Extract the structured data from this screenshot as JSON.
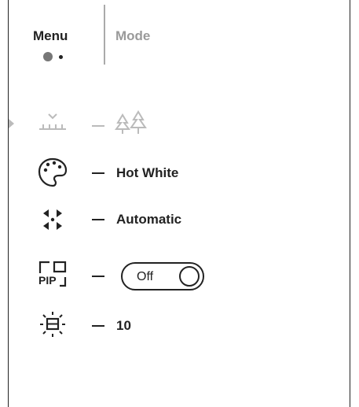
{
  "tabs": [
    {
      "label": "Menu",
      "active": true
    },
    {
      "label": "Mode",
      "active": false
    }
  ],
  "rows": [
    {
      "icon": "terrain-mode-icon",
      "value_icon": "forest-icon"
    },
    {
      "icon": "color-palette-icon",
      "value": "Hot White"
    },
    {
      "icon": "calibration-arrows-icon",
      "value": "Automatic"
    },
    {
      "icon": "pip-icon",
      "icon_text": "PIP",
      "toggle": {
        "label": "Off",
        "state": "off"
      }
    },
    {
      "icon": "display-brightness-icon",
      "value": "10"
    }
  ],
  "colors": {
    "active": "#222222",
    "inactive": "#9a9a9a",
    "disabled": "#bbbbbb"
  }
}
